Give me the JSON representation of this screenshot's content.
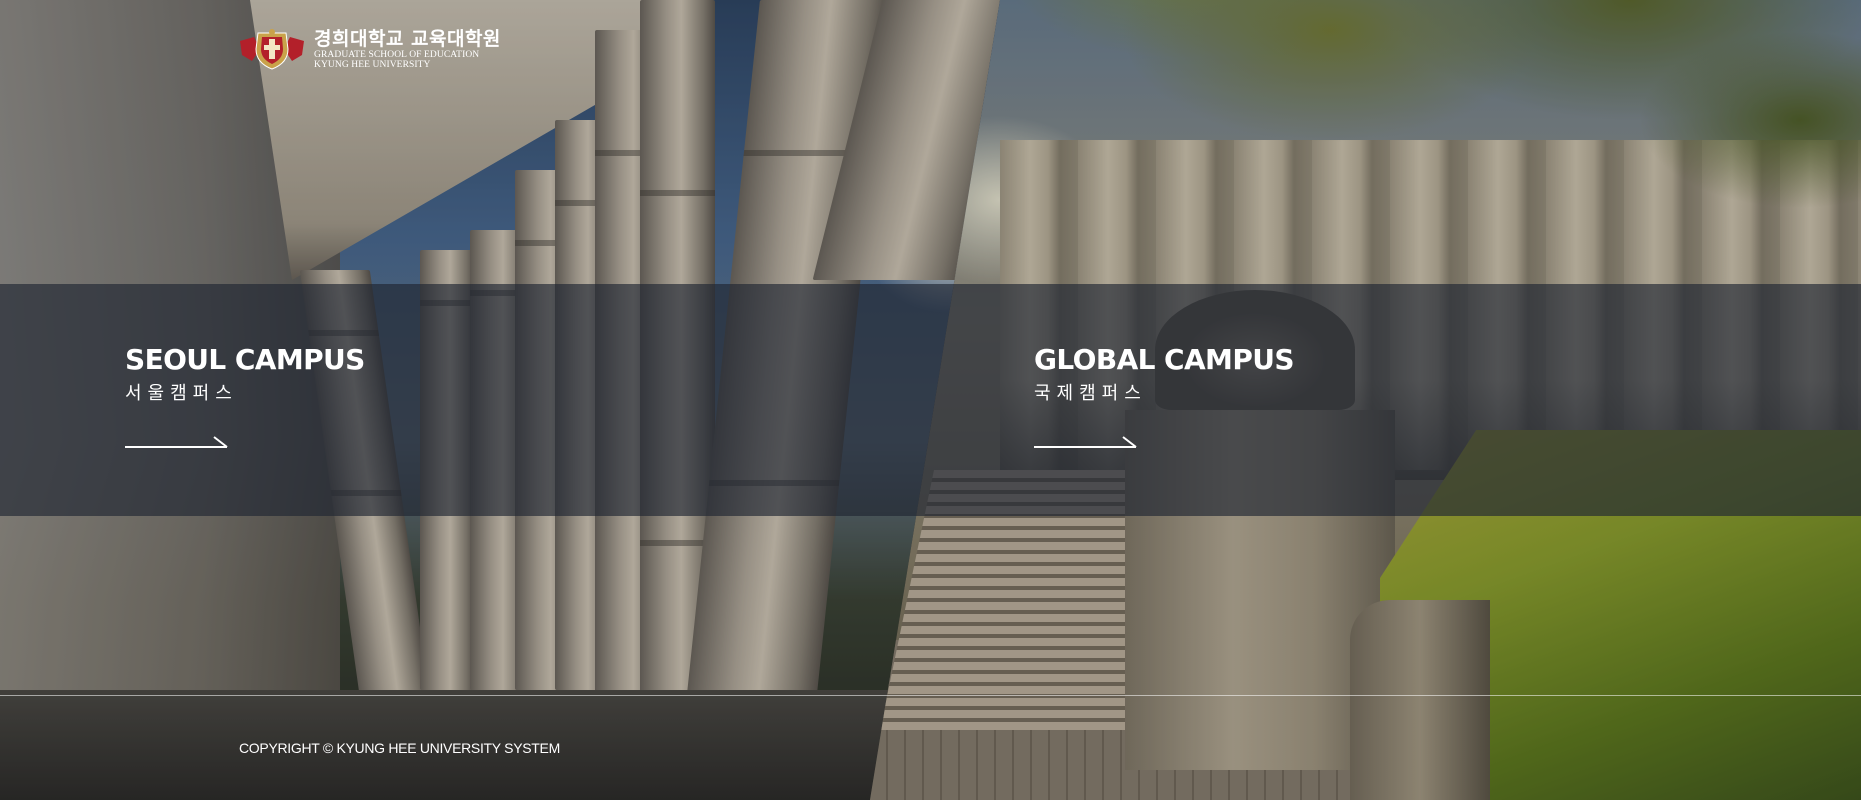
{
  "logo": {
    "name_ko": "경희대학교 교육대학원",
    "name_en_1": "GRADUATE SCHOOL OF EDUCATION",
    "name_en_2": "KYUNG HEE UNIVERSITY",
    "emblem_icon": "kyung-hee-emblem-icon"
  },
  "campuses": [
    {
      "title": "SEOUL CAMPUS",
      "subtitle": "서울캠퍼스",
      "arrow_icon": "arrow-right-icon"
    },
    {
      "title": "GLOBAL CAMPUS",
      "subtitle": "국제캠퍼스",
      "arrow_icon": "arrow-right-icon"
    }
  ],
  "footer": {
    "copyright": "COPYRIGHT © KYUNG HEE UNIVERSITY SYSTEM"
  },
  "colors": {
    "text": "#ffffff",
    "band_overlay": "rgba(32,38,50,0.66)",
    "emblem_red": "#b3202a",
    "emblem_gold": "#c9a24a"
  }
}
